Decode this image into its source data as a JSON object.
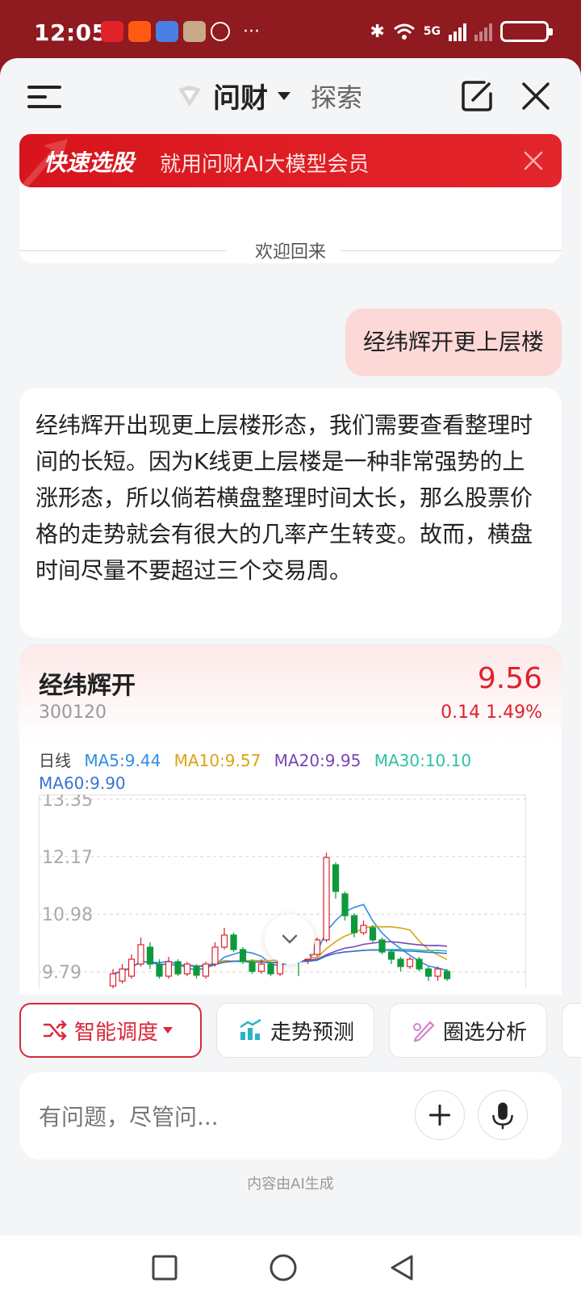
{
  "status": {
    "time": "12:05",
    "network": "5G",
    "dots": "···"
  },
  "header": {
    "title": "问财",
    "explore": "探索"
  },
  "promo": {
    "title": "快速选股",
    "subtitle": "就用问财AI大模型会员"
  },
  "chat": {
    "welcome": "欢迎回来",
    "user_message": "经纬辉开更上层楼",
    "answer": "经纬辉开出现更上层楼形态，我们需要查看整理时间的长短。因为K线更上层楼是一种非常强势的上涨形态，所以倘若横盘整理时间太长，那么股票价格的走势就会有很大的几率产生转变。故而，横盘时间尽量不要超过三个交易周。"
  },
  "stock": {
    "name": "经纬辉开",
    "code": "300120",
    "price": "9.56",
    "change": "0.14 1.49%",
    "period": "日线",
    "ma5": "MA5:9.44",
    "ma10": "MA10:9.57",
    "ma20": "MA20:9.95",
    "ma30": "MA30:10.10",
    "ma60": "MA60:9.90",
    "colors": {
      "up": "#e0202c",
      "down": "#0e9a3c",
      "ma5": "#2f8ee0",
      "ma10": "#d9a514",
      "ma20": "#7a44b8",
      "ma30": "#2fc1a4",
      "ma60": "#3a73d0"
    }
  },
  "chart_data": {
    "type": "line",
    "title": "",
    "y_ticks": [
      "13.35",
      "12.17",
      "10.98",
      "9.79"
    ],
    "ylim": [
      9.4,
      13.35
    ],
    "candles": [
      {
        "o": 9.5,
        "c": 9.75,
        "h": 9.85,
        "l": 9.45
      },
      {
        "o": 9.6,
        "c": 9.85,
        "h": 9.95,
        "l": 9.55
      },
      {
        "o": 9.7,
        "c": 10.05,
        "h": 10.15,
        "l": 9.65
      },
      {
        "o": 9.95,
        "c": 10.35,
        "h": 10.5,
        "l": 9.9
      },
      {
        "o": 10.3,
        "c": 9.95,
        "h": 10.4,
        "l": 9.85
      },
      {
        "o": 9.95,
        "c": 9.7,
        "h": 10.05,
        "l": 9.65
      },
      {
        "o": 9.7,
        "c": 10.0,
        "h": 10.1,
        "l": 9.65
      },
      {
        "o": 10.0,
        "c": 9.75,
        "h": 10.05,
        "l": 9.7
      },
      {
        "o": 9.75,
        "c": 9.95,
        "h": 10.0,
        "l": 9.7
      },
      {
        "o": 9.9,
        "c": 9.72,
        "h": 9.95,
        "l": 9.65
      },
      {
        "o": 9.7,
        "c": 9.95,
        "h": 10.0,
        "l": 9.65
      },
      {
        "o": 9.95,
        "c": 10.3,
        "h": 10.4,
        "l": 9.9
      },
      {
        "o": 10.3,
        "c": 10.55,
        "h": 10.7,
        "l": 10.25
      },
      {
        "o": 10.55,
        "c": 10.25,
        "h": 10.6,
        "l": 10.2
      },
      {
        "o": 10.25,
        "c": 10.0,
        "h": 10.3,
        "l": 9.95
      },
      {
        "o": 10.0,
        "c": 9.8,
        "h": 10.05,
        "l": 9.75
      },
      {
        "o": 9.8,
        "c": 9.95,
        "h": 10.05,
        "l": 9.75
      },
      {
        "o": 9.95,
        "c": 9.75,
        "h": 10.0,
        "l": 9.7
      },
      {
        "o": 9.75,
        "c": 10.1,
        "h": 10.2,
        "l": 9.7
      },
      {
        "o": 10.1,
        "c": 10.3,
        "h": 10.45,
        "l": 10.05
      },
      {
        "o": 10.3,
        "c": 10.05,
        "h": 10.35,
        "l": 9.7
      },
      {
        "o": 10.05,
        "c": 10.15,
        "h": 10.25,
        "l": 9.95
      },
      {
        "o": 10.15,
        "c": 10.45,
        "h": 10.5,
        "l": 10.1
      },
      {
        "o": 10.45,
        "c": 12.15,
        "h": 12.25,
        "l": 10.4
      },
      {
        "o": 12.0,
        "c": 11.45,
        "h": 12.05,
        "l": 11.3
      },
      {
        "o": 11.4,
        "c": 10.95,
        "h": 11.45,
        "l": 10.85
      },
      {
        "o": 10.95,
        "c": 10.6,
        "h": 11.0,
        "l": 10.5
      },
      {
        "o": 10.6,
        "c": 10.75,
        "h": 10.85,
        "l": 10.55
      },
      {
        "o": 10.7,
        "c": 10.45,
        "h": 10.75,
        "l": 10.4
      },
      {
        "o": 10.45,
        "c": 10.2,
        "h": 10.5,
        "l": 10.15
      },
      {
        "o": 10.2,
        "c": 10.05,
        "h": 10.25,
        "l": 9.95
      },
      {
        "o": 10.05,
        "c": 9.9,
        "h": 10.1,
        "l": 9.8
      },
      {
        "o": 9.9,
        "c": 10.05,
        "h": 10.1,
        "l": 9.85
      },
      {
        "o": 10.05,
        "c": 9.85,
        "h": 10.1,
        "l": 9.8
      },
      {
        "o": 9.85,
        "c": 9.7,
        "h": 9.9,
        "l": 9.6
      },
      {
        "o": 9.7,
        "c": 9.85,
        "h": 9.9,
        "l": 9.6
      },
      {
        "o": 9.8,
        "c": 9.65,
        "h": 9.85,
        "l": 9.6
      }
    ]
  },
  "actions": {
    "smart": "智能调度",
    "trend": "走势预测",
    "circle": "圈选分析"
  },
  "composer": {
    "placeholder": "有问题，尽管问...",
    "note": "内容由AI生成"
  }
}
